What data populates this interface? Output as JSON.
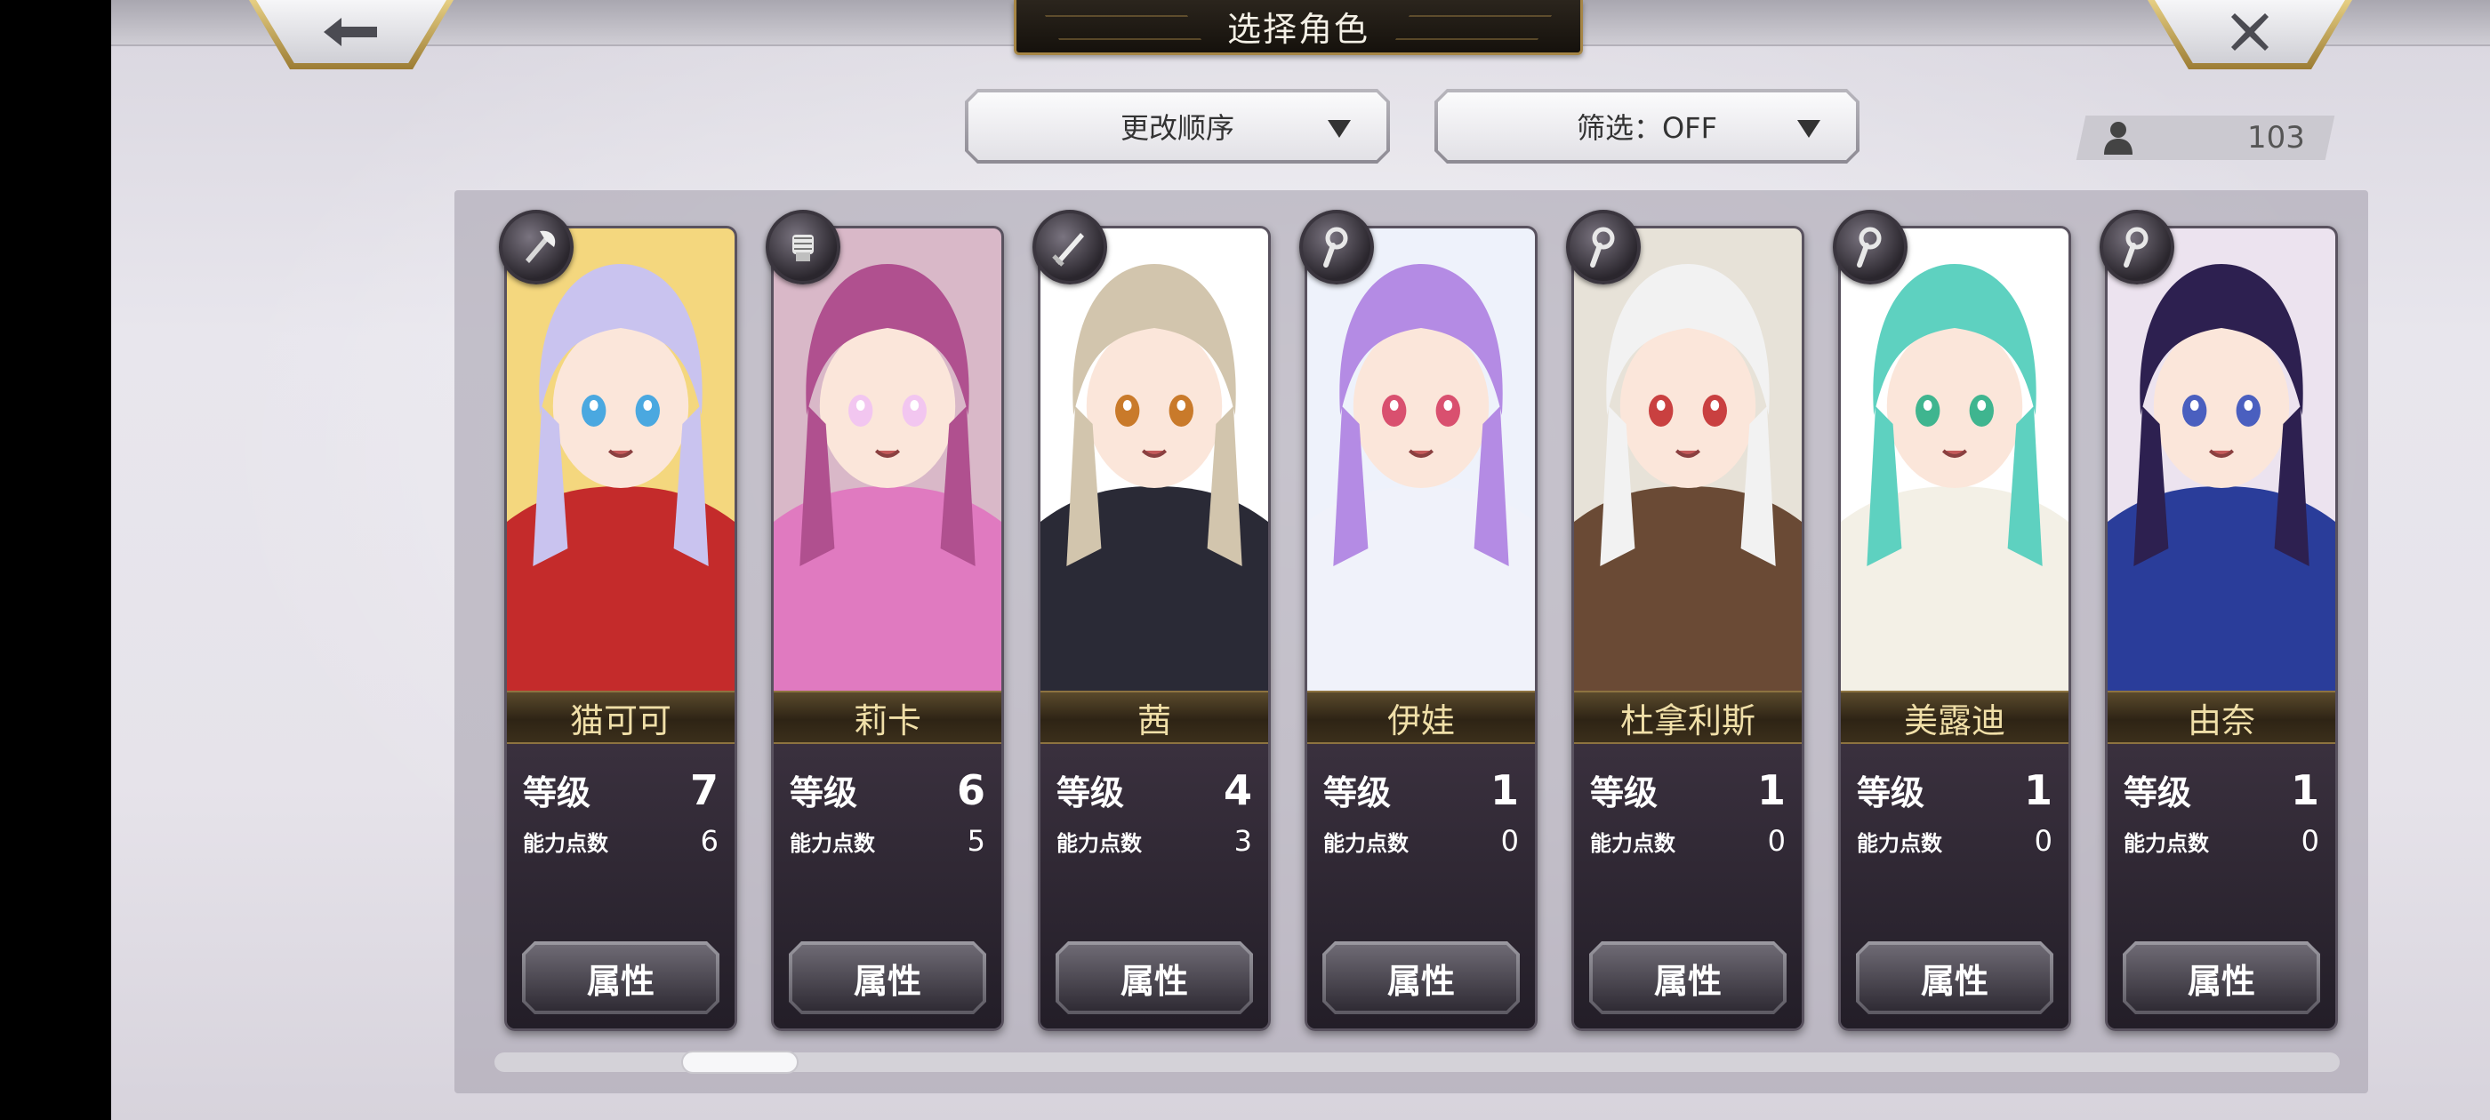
{
  "header": {
    "title": "选择角色",
    "back_icon": "arrow-left-icon",
    "close_icon": "close-icon"
  },
  "toolbar": {
    "sort_label": "更改顺序",
    "filter_label": "筛选：OFF",
    "unit_count": "103",
    "counter_icon": "person-icon"
  },
  "labels": {
    "level": "等级",
    "ability_points": "能力点数",
    "attributes_button": "属性"
  },
  "characters": [
    {
      "name": "猫可可",
      "level": "7",
      "ability_points": "6",
      "class_icon": "axe-icon",
      "bg": "#f4d77e",
      "hair": "#c9c3ef",
      "outfit": "#c42b2b",
      "eye": "#4aa8e0"
    },
    {
      "name": "莉卡",
      "level": "6",
      "ability_points": "5",
      "class_icon": "gauntlet-icon",
      "bg": "#d9b8c8",
      "hair": "#b0508f",
      "outfit": "#e07ac0",
      "eye": "#f2c6f0"
    },
    {
      "name": "茜",
      "level": "4",
      "ability_points": "3",
      "class_icon": "sword-icon",
      "bg": "#ffffff",
      "hair": "#d2c5ad",
      "outfit": "#2a2a36",
      "eye": "#c97a2a"
    },
    {
      "name": "伊娃",
      "level": "1",
      "ability_points": "0",
      "class_icon": "staff-icon",
      "bg": "#eef2fb",
      "hair": "#b48be4",
      "outfit": "#f0f2fa",
      "eye": "#d9506f"
    },
    {
      "name": "杜拿利斯",
      "level": "1",
      "ability_points": "0",
      "class_icon": "staff-icon",
      "bg": "#e7e2d8",
      "hair": "#f2f2f2",
      "outfit": "#6a4a35",
      "eye": "#c94040"
    },
    {
      "name": "美露迪",
      "level": "1",
      "ability_points": "0",
      "class_icon": "staff-icon",
      "bg": "#ffffff",
      "hair": "#5ed1c0",
      "outfit": "#f3f0e6",
      "eye": "#3fb58f"
    },
    {
      "name": "由奈",
      "level": "1",
      "ability_points": "0",
      "class_icon": "staff-icon",
      "bg": "#ece3ef",
      "hair": "#2d2050",
      "outfit": "#2a3d9a",
      "eye": "#4a5fbf"
    }
  ],
  "scroll": {
    "position": 0.18
  }
}
